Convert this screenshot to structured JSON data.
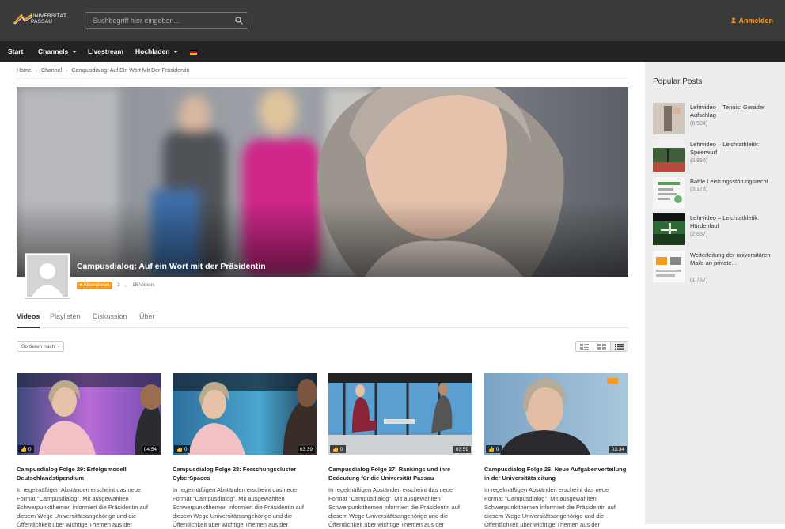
{
  "header": {
    "logo_text_line1": "UNIVERSITÄT",
    "logo_text_line2": "PASSAU",
    "search_placeholder": "Suchbegriff hier eingeben...",
    "login_label": "Anmelden"
  },
  "nav": {
    "items": [
      "Start",
      "Channels",
      "Livestream",
      "Hochladen"
    ],
    "language": "de"
  },
  "breadcrumb": [
    "Home",
    "Channel",
    "Campusdialog: Auf Ein Wort Mit Der Präsidentin"
  ],
  "channel": {
    "title": "Campusdialog: Auf ein Wort mit der Präsidentin",
    "subscribe_label": "Abonnieren",
    "subscriber_count": "2",
    "separator": ",",
    "video_count": "15 Videos"
  },
  "tabs": [
    "Videos",
    "Playlisten",
    "Diskussion",
    "Über"
  ],
  "sort_label": "Sortieren nach",
  "videos": [
    {
      "title": "Campusdialog Folge 29: Erfolgsmodell Deutschlandstipendium",
      "desc": "In regelmäßigen Abständen erscheint das neue Format \"Campusdialog\". Mit ausgewählten Schwerpunktthemen informiert die Präsidentin auf diesem Wege Universitätsangehörige und die Öffentlichkeit über wichtige Themen aus der",
      "likes": "0",
      "duration": "04:54"
    },
    {
      "title": "Campusdialog Folge 28: Forschungscluster CyberSpaces",
      "desc": "In regelmäßigen Abständen erscheint das neue Format \"Campusdialog\". Mit ausgewählten Schwerpunktthemen informiert die Präsidentin auf diesem Wege Universitätsangehörige und die Öffentlichkeit über wichtige Themen aus der",
      "likes": "0",
      "duration": "03:39"
    },
    {
      "title": "Campusdialog Folge 27: Rankings und ihre Bedeutung für die Universität Passau",
      "desc": "In regelmäßigen Abständen erscheint das neue Format \"Campusdialog\". Mit ausgewählten Schwerpunktthemen informiert die Präsidentin auf diesem Wege Universitätsangehörige und die Öffentlichkeit über wichtige Themen aus der",
      "likes": "0",
      "duration": "03:59"
    },
    {
      "title": "Campusdialog Folge 26: Neue Aufgabenverteilung in der Universitätsleitung",
      "desc": "In regelmäßigen Abständen erscheint das neue Format \"Campusdialog\". Mit ausgewählten Schwerpunktthemen informiert die Präsidentin auf diesem Wege Universitätsangehörige und die Öffentlichkeit über wichtige Themen aus der",
      "likes": "0",
      "duration": "03:34"
    }
  ],
  "sidebar": {
    "title": "Popular Posts",
    "posts": [
      {
        "title": "Lehrvideo – Tennis: Gerader Aufschlag",
        "views": "(6.504)"
      },
      {
        "title": "Lehrvideo – Leichtathletik: Speerwurf",
        "views": "(3.858)"
      },
      {
        "title": "Battle Leistungsstörungsrecht",
        "views": "(3.178)"
      },
      {
        "title": "Lehrvideo – Leichtathletik: Hürdenlauf",
        "views": "(2.637)"
      },
      {
        "title": "Weiterleitung der universitären Mails an private...",
        "views": "(1.767)"
      }
    ]
  },
  "colors": {
    "accent": "#f49b22",
    "topbar": "#3a3a3a",
    "nav": "#232323",
    "sidebar": "#ededed"
  }
}
